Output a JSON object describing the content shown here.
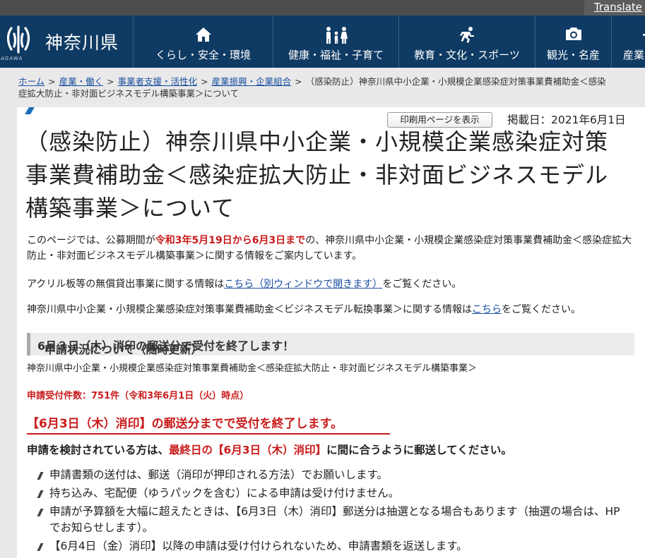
{
  "topbar": {
    "translate_label": "Translate"
  },
  "header": {
    "site_name": "神奈川県",
    "site_sub": "AGAWA",
    "nav": [
      {
        "label": "くらし・安全・環境",
        "icon": "house-icon"
      },
      {
        "label": "健康・福祉・子育て",
        "icon": "family-icon"
      },
      {
        "label": "教育・文化・スポーツ",
        "icon": "runner-icon"
      },
      {
        "label": "観光・名産",
        "icon": "camera-icon"
      },
      {
        "label": "産業",
        "icon": "industry-icon"
      }
    ]
  },
  "breadcrumb": {
    "items": [
      "ホーム",
      "産業・働く",
      "事業者支援・活性化",
      "産業振興・企業組合"
    ],
    "current_line1": "（感染防止）神奈川県中小企業・小規模企業感染症対策事業費補助金＜感染",
    "current_line2": "症拡大防止・非対面ビジネスモデル構築事業＞について",
    "current_tail": "について",
    "separator": ">"
  },
  "page": {
    "print_label": "印刷用ページを表示",
    "published": "掲載日：2021年6月1日",
    "title": "（感染防止）神奈川県中小企業・小規模企業感染症対策事業費補助金＜感染症拡大防止・非対面ビジネスモデル構築事業＞について",
    "intro_a": "このページでは、公募期間が",
    "intro_period_start": "令和3年5月19日から",
    "intro_period_end": "6月3日まで",
    "intro_b": "の、神奈川県中小企業・小規模企業感染症対策事業費補助金＜感染症拡大防止・非対面ビジネスモデル構築事業＞に関する情報をご案内しています。",
    "acrylic_a": "アクリル板等の無償貸出事業に関する情報は",
    "acrylic_link": "こちら（別ウィンドウで開きます）",
    "acrylic_b": "をご覧ください。",
    "convert_a": "神奈川県中小企業・小規模企業感染症対策事業費補助金＜ビジネスモデル転換事業＞に関する情報は",
    "convert_link": "こちら",
    "convert_b": "をご覧ください。",
    "section_head": "申請状況について（随時更新）",
    "section_head_red": "6月３日（木）消印の郵送分で受付を終了します！",
    "program_name": "神奈川県中小企業・小規模企業感染症対策事業費補助金＜感染症拡大防止・非対面ビジネスモデル構築事業＞",
    "count": "申請受付件数：751件（令和3年6月1日（火）時点）",
    "closing": "【6月3日（木）消印】の郵送分までで受付を終了します。",
    "note_a": "申請を検討されている方は、",
    "note_red": "最終日の【6月3日（木）消印】",
    "note_b": "に間に合うように郵送してください。",
    "bullets": [
      "申請書類の送付は、郵送（消印が押印される方法）でお願いします。",
      "持ち込み、宅配便（ゆうパックを含む）による申請は受け付けません。",
      "申請が予算額を大幅に超えたときは、【6月3日（木）消印】郵送分は抽選となる場合もあります（抽選の場合は、HPでお知らせします）。",
      "【6月4日（金）消印】以降の申請は受け付けられないため、申請書類を返送します。"
    ]
  },
  "colors": {
    "header_bg": "#0e3a63",
    "link": "#1a4fa0",
    "alert_red": "#c91c1c"
  }
}
